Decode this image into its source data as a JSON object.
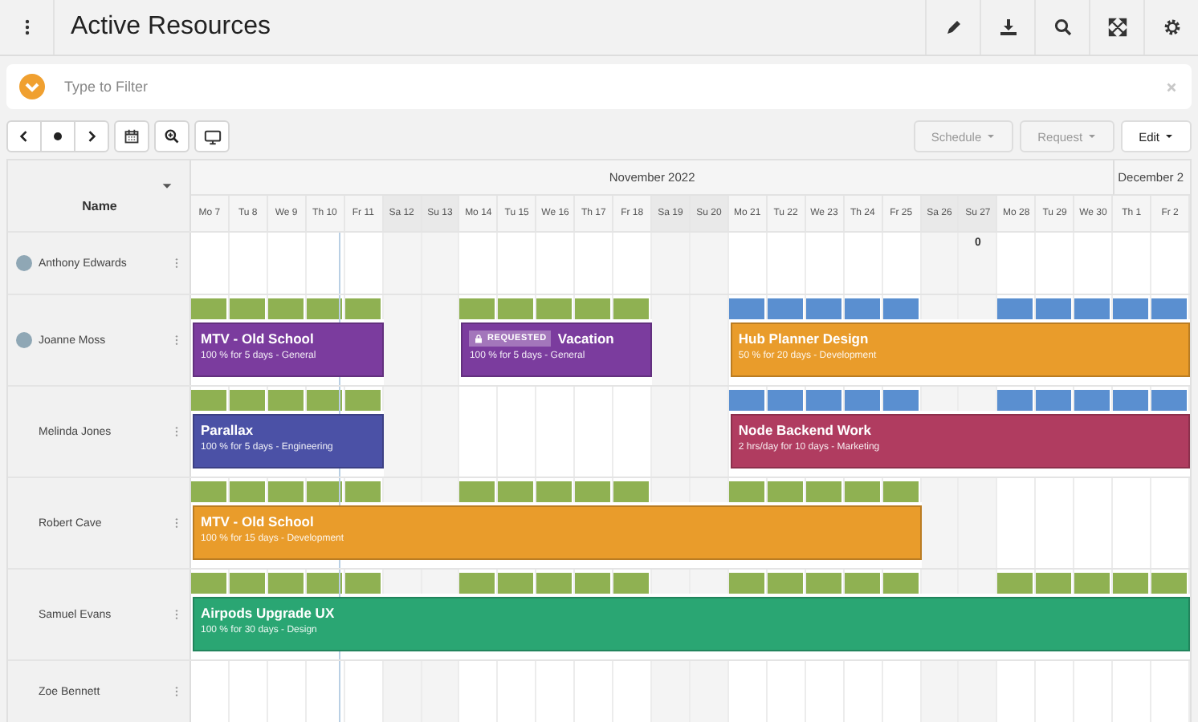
{
  "header": {
    "title": "Active Resources"
  },
  "filter": {
    "placeholder": "Type to Filter"
  },
  "toolbar": {
    "menus": [
      {
        "label": "Schedule",
        "disabled": true
      },
      {
        "label": "Request",
        "disabled": true
      },
      {
        "label": "Edit",
        "disabled": false
      }
    ]
  },
  "grid": {
    "name_heading": "Name",
    "months": [
      "November 2022",
      "December 2"
    ],
    "days": [
      {
        "label": "Mo 7",
        "weekend": false
      },
      {
        "label": "Tu 8",
        "weekend": false
      },
      {
        "label": "We 9",
        "weekend": false
      },
      {
        "label": "Th 10",
        "weekend": false,
        "today": true
      },
      {
        "label": "Fr 11",
        "weekend": false
      },
      {
        "label": "Sa 12",
        "weekend": true
      },
      {
        "label": "Su 13",
        "weekend": true
      },
      {
        "label": "Mo 14",
        "weekend": false
      },
      {
        "label": "Tu 15",
        "weekend": false
      },
      {
        "label": "We 16",
        "weekend": false
      },
      {
        "label": "Th 17",
        "weekend": false
      },
      {
        "label": "Fr 18",
        "weekend": false
      },
      {
        "label": "Sa 19",
        "weekend": true
      },
      {
        "label": "Su 20",
        "weekend": true
      },
      {
        "label": "Mo 21",
        "weekend": false
      },
      {
        "label": "Tu 22",
        "weekend": false
      },
      {
        "label": "We 23",
        "weekend": false
      },
      {
        "label": "Th 24",
        "weekend": false
      },
      {
        "label": "Fr 25",
        "weekend": false
      },
      {
        "label": "Sa 26",
        "weekend": true
      },
      {
        "label": "Su 27",
        "weekend": true
      },
      {
        "label": "Mo 28",
        "weekend": false
      },
      {
        "label": "Tu 29",
        "weekend": false
      },
      {
        "label": "We 30",
        "weekend": false
      },
      {
        "label": "Th 1",
        "weekend": false,
        "month_start": true
      },
      {
        "label": "Fr 2",
        "weekend": false
      }
    ],
    "rows": [
      {
        "name": "Anthony Edwards",
        "avatar": true,
        "days": [
          {
            "filled": false
          },
          {
            "filled": false
          },
          {
            "filled": false
          },
          {
            "filled": false
          },
          {
            "filled": false
          },
          {
            "filled": false
          },
          {
            "filled": false
          },
          {
            "filled": false
          },
          {
            "filled": false
          },
          {
            "filled": false
          },
          {
            "filled": false
          },
          {
            "filled": false
          },
          {
            "filled": false
          },
          {
            "filled": false
          },
          {
            "filled": false
          },
          {
            "filled": false
          },
          {
            "filled": false
          },
          {
            "filled": false
          },
          {
            "filled": false
          },
          {
            "filled": false
          },
          {
            "filled": false,
            "count": "0"
          },
          {
            "filled": false
          },
          {
            "filled": false
          },
          {
            "filled": false
          },
          {
            "filled": false
          },
          {
            "filled": false
          }
        ]
      },
      {
        "name": "Joanne Moss",
        "avatar": true,
        "days": [
          {
            "filled": true,
            "color": "#8fb152",
            "start": true
          },
          {
            "filled": true,
            "color": "#8fb152"
          },
          {
            "filled": true,
            "color": "#8fb152"
          },
          {
            "filled": true,
            "color": "#8fb152"
          },
          {
            "filled": true,
            "color": "#8fb152",
            "end": true
          },
          {
            "filled": false
          },
          {
            "filled": false
          },
          {
            "filled": true,
            "color": "#8fb152",
            "start": true
          },
          {
            "filled": true,
            "color": "#8fb152"
          },
          {
            "filled": true,
            "color": "#8fb152"
          },
          {
            "filled": true,
            "color": "#8fb152"
          },
          {
            "filled": true,
            "color": "#8fb152",
            "end": true
          },
          {
            "filled": false
          },
          {
            "filled": false
          },
          {
            "filled": true,
            "color": "#5a8fd0",
            "start": true
          },
          {
            "filled": true,
            "color": "#5a8fd0"
          },
          {
            "filled": true,
            "color": "#5a8fd0"
          },
          {
            "filled": true,
            "color": "#5a8fd0"
          },
          {
            "filled": true,
            "color": "#5a8fd0"
          },
          {
            "filled": false
          },
          {
            "filled": false
          },
          {
            "filled": true,
            "color": "#5a8fd0"
          },
          {
            "filled": true,
            "color": "#5a8fd0"
          },
          {
            "filled": true,
            "color": "#5a8fd0"
          },
          {
            "filled": true,
            "color": "#5a8fd0"
          },
          {
            "filled": true,
            "color": "#5a8fd0",
            "end": true
          }
        ],
        "bookings": [
          {
            "title": "MTV - Old School",
            "detail": "100 % for 5 days - General",
            "color": "#7b3c9e"
          },
          {
            "title": "Vacation",
            "badge": "REQUESTED",
            "detail": "100 % for 5 days - General",
            "color": "#7b3c9e"
          },
          {
            "title": "Hub Planner Design",
            "detail": "50 % for 20 days - Development",
            "color": "#e99c2b"
          }
        ]
      },
      {
        "name": "Melinda Jones",
        "avatar": false,
        "days": [
          {
            "filled": true,
            "color": "#8fb152",
            "start": true
          },
          {
            "filled": true,
            "color": "#8fb152"
          },
          {
            "filled": true,
            "color": "#8fb152"
          },
          {
            "filled": true,
            "color": "#8fb152"
          },
          {
            "filled": true,
            "color": "#8fb152",
            "end": true
          },
          {
            "filled": false
          },
          {
            "filled": false
          },
          {
            "filled": false
          },
          {
            "filled": false
          },
          {
            "filled": false
          },
          {
            "filled": false
          },
          {
            "filled": false
          },
          {
            "filled": false
          },
          {
            "filled": false
          },
          {
            "filled": true,
            "color": "#5a8fd0",
            "start": true
          },
          {
            "filled": true,
            "color": "#5a8fd0"
          },
          {
            "filled": true,
            "color": "#5a8fd0"
          },
          {
            "filled": true,
            "color": "#5a8fd0"
          },
          {
            "filled": true,
            "color": "#5a8fd0"
          },
          {
            "filled": false
          },
          {
            "filled": false
          },
          {
            "filled": true,
            "color": "#5a8fd0"
          },
          {
            "filled": true,
            "color": "#5a8fd0"
          },
          {
            "filled": true,
            "color": "#5a8fd0"
          },
          {
            "filled": true,
            "color": "#5a8fd0"
          },
          {
            "filled": true,
            "color": "#5a8fd0",
            "end": true
          }
        ],
        "bookings": [
          {
            "title": "Parallax",
            "detail": "100 % for 5 days - Engineering",
            "color": "#4b51a6"
          },
          {
            "title": "Node Backend Work",
            "detail": "2 hrs/day for 10 days - Marketing",
            "color": "#b03c60"
          }
        ]
      },
      {
        "name": "Robert Cave",
        "avatar": false,
        "days": [
          {
            "filled": true,
            "color": "#8fb152",
            "start": true
          },
          {
            "filled": true,
            "color": "#8fb152"
          },
          {
            "filled": true,
            "color": "#8fb152"
          },
          {
            "filled": true,
            "color": "#8fb152"
          },
          {
            "filled": true,
            "color": "#8fb152"
          },
          {
            "filled": false
          },
          {
            "filled": false
          },
          {
            "filled": true,
            "color": "#8fb152"
          },
          {
            "filled": true,
            "color": "#8fb152"
          },
          {
            "filled": true,
            "color": "#8fb152"
          },
          {
            "filled": true,
            "color": "#8fb152"
          },
          {
            "filled": true,
            "color": "#8fb152"
          },
          {
            "filled": false
          },
          {
            "filled": false
          },
          {
            "filled": true,
            "color": "#8fb152"
          },
          {
            "filled": true,
            "color": "#8fb152"
          },
          {
            "filled": true,
            "color": "#8fb152"
          },
          {
            "filled": true,
            "color": "#8fb152"
          },
          {
            "filled": true,
            "color": "#8fb152",
            "end": true
          },
          {
            "filled": false
          },
          {
            "filled": false
          },
          {
            "filled": false
          },
          {
            "filled": false
          },
          {
            "filled": false
          },
          {
            "filled": false
          },
          {
            "filled": false
          }
        ],
        "bookings": [
          {
            "title": "MTV - Old School",
            "detail": "100 % for 15 days - Development",
            "color": "#e99c2b"
          }
        ]
      },
      {
        "name": "Samuel Evans",
        "avatar": false,
        "days": [
          {
            "filled": true,
            "color": "#8fb152",
            "start": true
          },
          {
            "filled": true,
            "color": "#8fb152"
          },
          {
            "filled": true,
            "color": "#8fb152"
          },
          {
            "filled": true,
            "color": "#8fb152"
          },
          {
            "filled": true,
            "color": "#8fb152"
          },
          {
            "filled": false
          },
          {
            "filled": false
          },
          {
            "filled": true,
            "color": "#8fb152"
          },
          {
            "filled": true,
            "color": "#8fb152"
          },
          {
            "filled": true,
            "color": "#8fb152"
          },
          {
            "filled": true,
            "color": "#8fb152"
          },
          {
            "filled": true,
            "color": "#8fb152"
          },
          {
            "filled": false
          },
          {
            "filled": false
          },
          {
            "filled": true,
            "color": "#8fb152"
          },
          {
            "filled": true,
            "color": "#8fb152"
          },
          {
            "filled": true,
            "color": "#8fb152"
          },
          {
            "filled": true,
            "color": "#8fb152"
          },
          {
            "filled": true,
            "color": "#8fb152"
          },
          {
            "filled": false
          },
          {
            "filled": false
          },
          {
            "filled": true,
            "color": "#8fb152"
          },
          {
            "filled": true,
            "color": "#8fb152"
          },
          {
            "filled": true,
            "color": "#8fb152"
          },
          {
            "filled": true,
            "color": "#8fb152"
          },
          {
            "filled": true,
            "color": "#8fb152",
            "end": true
          }
        ],
        "bookings": [
          {
            "title": "Airpods Upgrade UX",
            "detail": "100 % for 30 days - Design",
            "color": "#2aa673"
          }
        ]
      },
      {
        "name": "Zoe Bennett",
        "avatar": false,
        "days": [
          {
            "filled": false
          },
          {
            "filled": false
          },
          {
            "filled": false
          },
          {
            "filled": false
          },
          {
            "filled": false
          },
          {
            "filled": false
          },
          {
            "filled": false
          },
          {
            "filled": false
          },
          {
            "filled": false
          },
          {
            "filled": false
          },
          {
            "filled": false
          },
          {
            "filled": false
          },
          {
            "filled": false
          },
          {
            "filled": false
          },
          {
            "filled": false
          },
          {
            "filled": false
          },
          {
            "filled": false
          },
          {
            "filled": false
          },
          {
            "filled": false
          },
          {
            "filled": false
          },
          {
            "filled": false
          },
          {
            "filled": false
          },
          {
            "filled": false
          },
          {
            "filled": false
          },
          {
            "filled": false
          },
          {
            "filled": false
          }
        ]
      }
    ]
  }
}
